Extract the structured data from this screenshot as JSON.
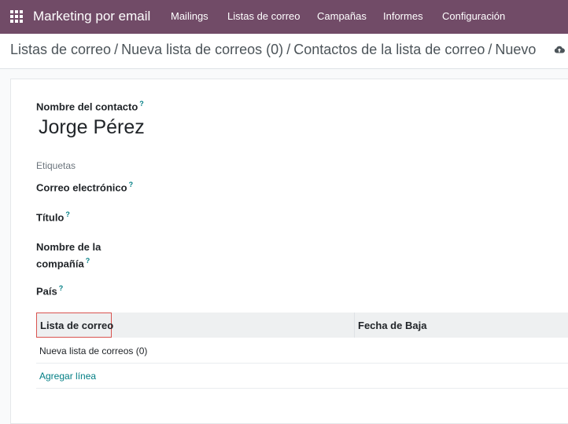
{
  "navbar": {
    "app_title": "Marketing por email",
    "menu": [
      "Mailings",
      "Listas de correo",
      "Campañas",
      "Informes",
      "Configuración"
    ]
  },
  "breadcrumb": {
    "items": [
      "Listas de correo",
      "Nueva lista de correos (0)",
      "Contactos de la lista de correo"
    ],
    "current": "Nuevo"
  },
  "form": {
    "contact_name_label": "Nombre del contacto",
    "contact_name_value": "Jorge Pérez",
    "tags_placeholder": "Etiquetas",
    "email_label": "Correo electrónico",
    "title_label": "Título",
    "company_label_line1": "Nombre de la",
    "company_label_line2": "compañía",
    "country_label": "País",
    "help_mark": "?"
  },
  "table": {
    "columns": [
      "Lista de correo",
      "Fecha de Baja"
    ],
    "rows": [
      [
        "Nueva lista de correos (0)",
        ""
      ]
    ],
    "add_line": "Agregar línea"
  },
  "colors": {
    "navbar": "#714b67",
    "link": "#017e84",
    "highlight_border": "#d9534f"
  },
  "icons": {
    "apps": "apps-grid-icon",
    "cloud": "cloud-upload-icon"
  }
}
